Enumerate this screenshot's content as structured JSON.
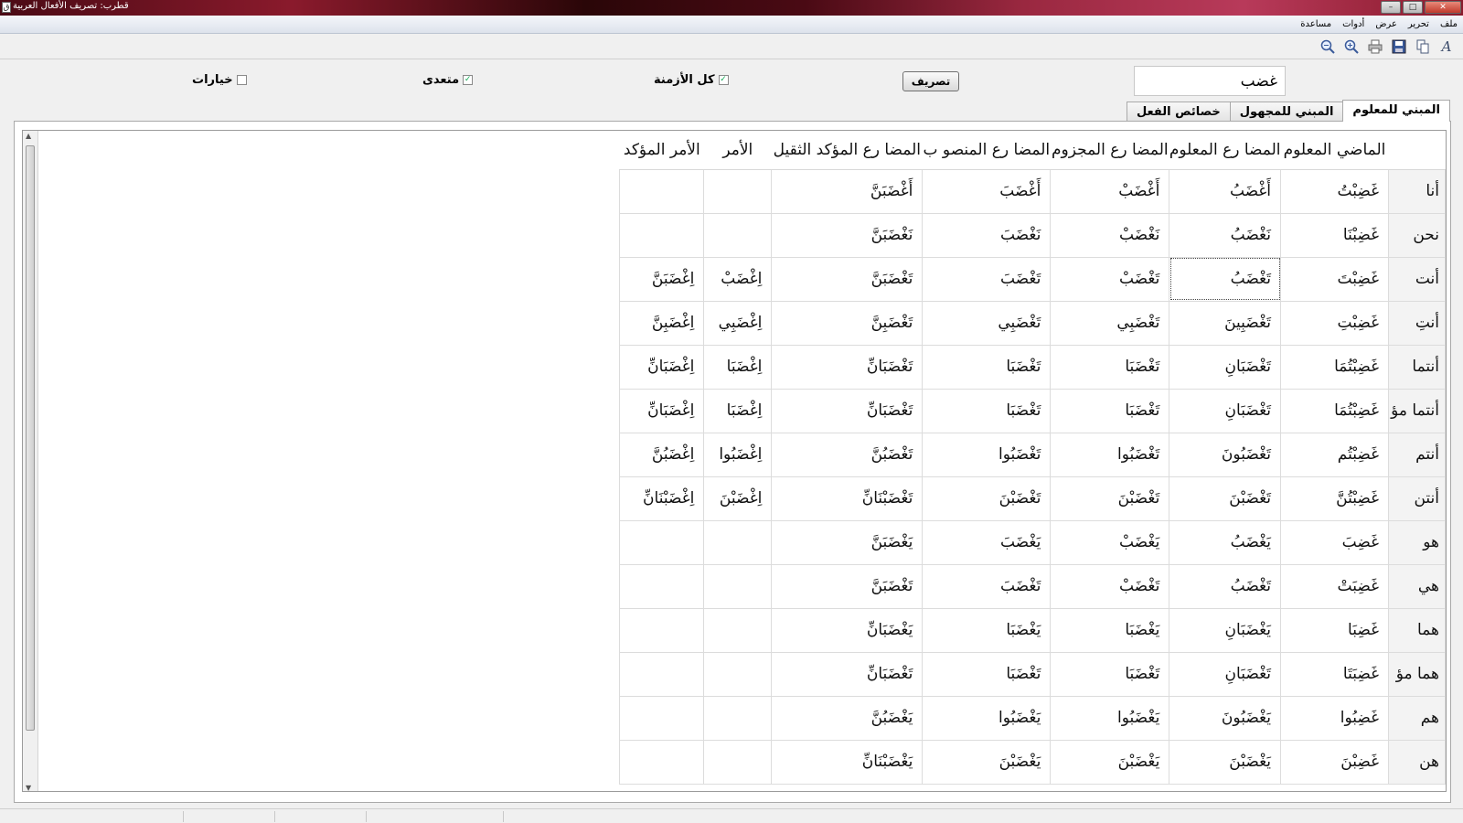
{
  "window": {
    "title": "قطرب: تصريف الأفعال العربية"
  },
  "menu": [
    "ملف",
    "تحرير",
    "عرض",
    "أدوات",
    "مساعدة"
  ],
  "toolbar": [
    "font-icon",
    "copy-icon",
    "save-icon",
    "print-icon",
    "zoom-in-icon",
    "zoom-out-icon"
  ],
  "form": {
    "verb": "غضب",
    "conjugate_label": "تصريف",
    "all_tenses_label": "كل الأزمنة",
    "all_tenses_checked": true,
    "transitive_label": "متعدى",
    "transitive_checked": true,
    "options_label": "خيارات",
    "options_checked": false
  },
  "tabs": [
    "المبني للمعلوم",
    "المبني للمجهول",
    "خصائص الفعل"
  ],
  "table": {
    "headers": [
      "",
      "الماضي المعلوم",
      "المضا رع المعلوم",
      "المضا رع المجزوم",
      "المضا رع المنصو ب",
      "المضا رع المؤكد الثقيل",
      "الأمر",
      "الأمر المؤكد"
    ],
    "rows": [
      [
        "أنا",
        "غَضِبْتُ",
        "أَغْضَبُ",
        "أَغْضَبْ",
        "أَغْضَبَ",
        "أَغْضَبَنَّ",
        "",
        ""
      ],
      [
        "نحن",
        "غَضِبْنَا",
        "نَغْضَبُ",
        "نَغْضَبْ",
        "نَغْضَبَ",
        "نَغْضَبَنَّ",
        "",
        ""
      ],
      [
        "أنت",
        "غَضِبْتَ",
        "تَغْضَبُ",
        "تَغْضَبْ",
        "تَغْضَبَ",
        "تَغْضَبَنَّ",
        "اِغْضَبْ",
        "اِغْضَبَنَّ"
      ],
      [
        "أنتِ",
        "غَضِبْتِ",
        "تَغْضَبِينَ",
        "تَغْضَبِي",
        "تَغْضَبِي",
        "تَغْضَبِنَّ",
        "اِغْضَبِي",
        "اِغْضَبِنَّ"
      ],
      [
        "أنتما",
        "غَضِبْتُمَا",
        "تَغْضَبَانِ",
        "تَغْضَبَا",
        "تَغْضَبَا",
        "تَغْضَبَانِّ",
        "اِغْضَبَا",
        "اِغْضَبَانِّ"
      ],
      [
        "أنتما مؤ",
        "غَضِبْتُمَا",
        "تَغْضَبَانِ",
        "تَغْضَبَا",
        "تَغْضَبَا",
        "تَغْضَبَانِّ",
        "اِغْضَبَا",
        "اِغْضَبَانِّ"
      ],
      [
        "أنتم",
        "غَضِبْتُم",
        "تَغْضَبُونَ",
        "تَغْضَبُوا",
        "تَغْضَبُوا",
        "تَغْضَبُنَّ",
        "اِغْضَبُوا",
        "اِغْضَبُنَّ"
      ],
      [
        "أنتن",
        "غَضِبْتُنَّ",
        "تَغْضَبْنَ",
        "تَغْضَبْنَ",
        "تَغْضَبْنَ",
        "تَغْضَبْنَانِّ",
        "اِغْضَبْنَ",
        "اِغْضَبْنَانِّ"
      ],
      [
        "هو",
        "غَضِبَ",
        "يَغْضَبُ",
        "يَغْضَبْ",
        "يَغْضَبَ",
        "يَغْضَبَنَّ",
        "",
        ""
      ],
      [
        "هي",
        "غَضِبَتْ",
        "تَغْضَبُ",
        "تَغْضَبْ",
        "تَغْضَبَ",
        "تَغْضَبَنَّ",
        "",
        ""
      ],
      [
        "هما",
        "غَضِبَا",
        "يَغْضَبَانِ",
        "يَغْضَبَا",
        "يَغْضَبَا",
        "يَغْضَبَانِّ",
        "",
        ""
      ],
      [
        "هما مؤ",
        "غَضِبَتَا",
        "تَغْضَبَانِ",
        "تَغْضَبَا",
        "تَغْضَبَا",
        "تَغْضَبَانِّ",
        "",
        ""
      ],
      [
        "هم",
        "غَضِبُوا",
        "يَغْضَبُونَ",
        "يَغْضَبُوا",
        "يَغْضَبُوا",
        "يَغْضَبُنَّ",
        "",
        ""
      ],
      [
        "هن",
        "غَضِبْنَ",
        "يَغْضَبْنَ",
        "يَغْضَبْنَ",
        "يَغْضَبْنَ",
        "يَغْضَبْنَانِّ",
        "",
        ""
      ]
    ],
    "selected_cell": {
      "row": 2,
      "col": 2
    }
  }
}
